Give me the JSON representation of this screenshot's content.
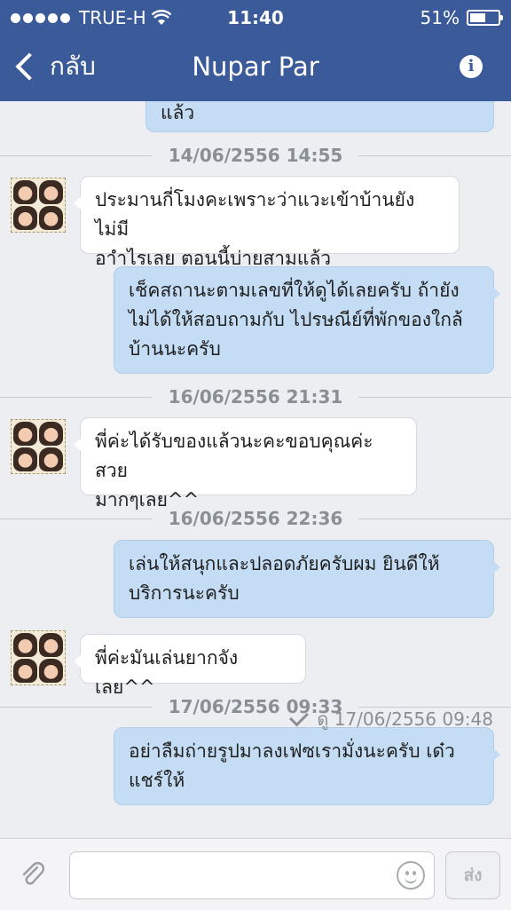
{
  "status_bar": {
    "carrier": "TRUE-H",
    "time": "11:40",
    "battery": "51%",
    "battery_level": 0.51
  },
  "nav": {
    "back_label": "กลับ",
    "title": "Nupar Par",
    "info_icon": "info-icon"
  },
  "messages": [
    {
      "type": "out",
      "text": "แล้ว"
    },
    {
      "type": "timestamp",
      "text": "14/06/2556 14:55"
    },
    {
      "type": "in",
      "lines": [
        "ประมานกี่โมงคะเพราะว่าแวะเข้าบ้านยังไม่มี",
        "อาำไรเลย ตอนนี้บ่ายสามแล้ว"
      ]
    },
    {
      "type": "out",
      "lines": [
        "เช็คสถานะตามเลขที่ให้ดูได้เลยครับ ถ้ายัง",
        "ไม่ได้ให้สอบถามกับ ไปรษณีย์ที่พักของใกล้",
        "บ้านนะครับ"
      ]
    },
    {
      "type": "timestamp",
      "text": "16/06/2556 21:31"
    },
    {
      "type": "in",
      "lines": [
        "พี่ค่ะได้รับของแล้วนะคะขอบคุณค่ะสวย",
        "มากๆเลย^^"
      ]
    },
    {
      "type": "timestamp",
      "text": "16/06/2556 22:36"
    },
    {
      "type": "out",
      "lines": [
        "เล่นให้สนุกและปลอดภัยครับผม ยินดีให้",
        "บริการนะครับ"
      ]
    },
    {
      "type": "in",
      "lines": [
        "พี่ค่ะมันเล่นยากจังเลย^^"
      ]
    },
    {
      "type": "timestamp",
      "text": "17/06/2556 09:33"
    },
    {
      "type": "out",
      "lines": [
        "อย่าลืมถ่ายรูปมาลงเฟซเรามั่งนะครับ เด๋ว",
        "แชร์ให้"
      ]
    }
  ],
  "seen_status": "ดู 17/06/2556 09:48",
  "composer": {
    "placeholder": "",
    "send_label": "ส่ง"
  }
}
